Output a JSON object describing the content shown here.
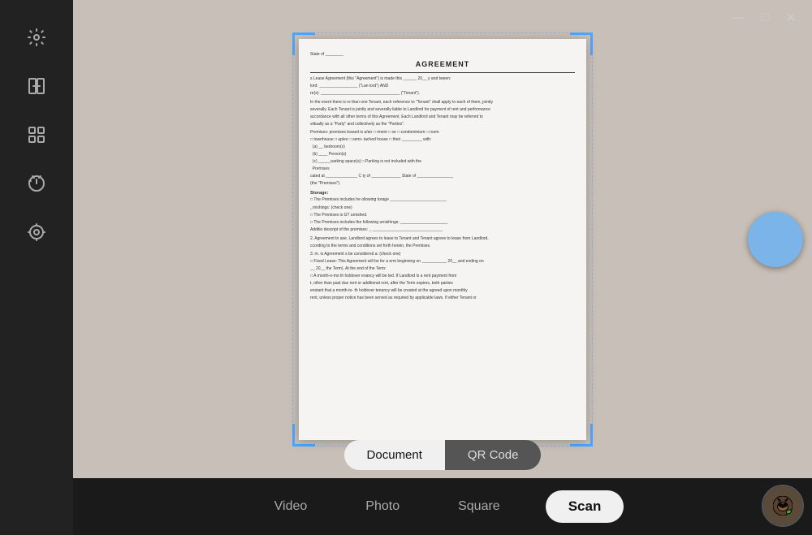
{
  "titleBar": {
    "minimizeLabel": "minimize",
    "maximizeLabel": "maximize",
    "closeLabel": "close"
  },
  "sidebar": {
    "icons": [
      {
        "name": "settings-icon",
        "symbol": "⚙"
      },
      {
        "name": "compare-icon",
        "symbol": "⊡"
      },
      {
        "name": "grid-icon",
        "symbol": "⊞"
      },
      {
        "name": "timer-icon",
        "symbol": "⊘"
      },
      {
        "name": "focus-icon",
        "symbol": "✣"
      }
    ]
  },
  "document": {
    "title": "AGREEMENT",
    "lines": [
      "State of ________",
      "s Lease Agreement (this \"Agreement\") is made this ______ 20__ y and  tween:",
      "lord: _________________ (\"Lan lord\") AND",
      "re(s): ___________________________________ (\"Tenant\").",
      "In the event there is  re than one Tenant, each reference to \"Tenant\" shall apply to each of them, jointly",
      "severally. Each Tenant is jointly and severally liable to Landlord for payment of rent and performance",
      "accordance with all other terms of this Agreement. Each Landlord and Tenant may be referred to",
      "vidually as a \"Party\" and collectively as the \"Parties\".",
      "Premises:  premises leased is a/an □ rment □  se □ condominium □ room",
      "□ townhouse □  uplex □ semi-  tached house □  their _________ with:",
      "(a) __ bedroom(s)",
      "(b) ____ Person(s)",
      "(c) _____ parking space(s) □  Parking is not included with the",
      "Premises",
      "cated at ______________ C ty of _____________ State of ________________",
      "(the \"Premises\").",
      "Storage:",
      "□ The Premises includes he ollowing  torage ________________________",
      "_rnishings: (check one)",
      "□ The Premises is  GT urnished.",
      "□ The Premises includes the following  urnishings: _____________________",
      "Additio  descript  of the premises: _  ________________________________",
      "2. Agreement to   ase.  Landlord agrees to lease to Tenant and Tenant agrees to lease  from Landlord,",
      "ccording to the terms and conditions set forth herein, the Premises.",
      "3.  m.  is Agreement s  be considered a: (check one)",
      "□ Fixed Lease: This Agreement will be for a  erm beginning on ___________ 20__ and ending on",
      "__ 20__  the Term). At the end of the Term:",
      "□ A month-o-mo th holdover  enancy will be     ted.  If Landlord    ls  a rent payment from",
      "t, other than past due rent or additional rent, after the Term expires, both parties",
      "enstant that a month-to-   th holdover tenancy will be created at the agreed upon monthly",
      "rent, unless proper notice has been served as required by applicable laws. If either Tenant or"
    ]
  },
  "modeTabs": {
    "documentLabel": "Document",
    "qrCodeLabel": "QR Code"
  },
  "captureBar": {
    "modes": [
      {
        "label": "Video",
        "key": "video"
      },
      {
        "label": "Photo",
        "key": "photo"
      },
      {
        "label": "Square",
        "key": "square"
      },
      {
        "label": "Scan",
        "key": "scan"
      }
    ],
    "activeMode": "scan"
  },
  "colors": {
    "accent": "#7ab4e8",
    "bracketColor": "#4da6ff",
    "tabActive": "#f0f0f0",
    "tabInactive": "#555555"
  }
}
